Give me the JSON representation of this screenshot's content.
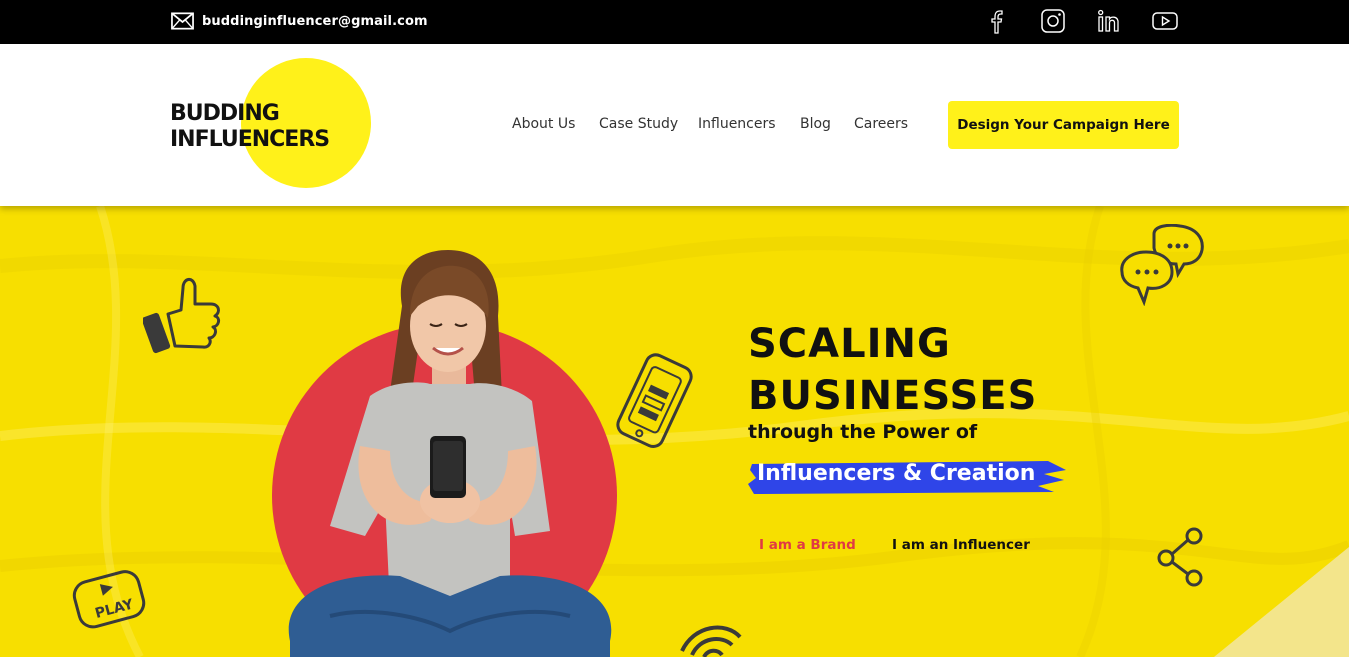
{
  "topbar": {
    "email": "buddinginfluencer@gmail.com",
    "icons": [
      "mail-icon",
      "facebook-icon",
      "instagram-icon",
      "linkedin-icon",
      "youtube-icon"
    ]
  },
  "header": {
    "logo_line1": "BUDDING",
    "logo_line2": "INFLUENCERS",
    "nav": [
      "About Us",
      "Case Study",
      "Influencers",
      "Blog",
      "Careers"
    ],
    "cta": "Design Your Campaign Here"
  },
  "hero": {
    "headline_line1": "SCALING",
    "headline_line2": "BUSINESSES",
    "subline": "through the Power of",
    "highlight": "Influencers & Creation",
    "brand_button": "I am a Brand",
    "influencer_button": "I am an Influencer",
    "doodles": [
      "thumbs-up-icon",
      "phone-doodle-icon",
      "chat-bubbles-icon",
      "share-icon",
      "play-button-icon",
      "wifi-icon"
    ]
  },
  "colors": {
    "accent_yellow": "#fff11a",
    "hero_yellow": "#f7df00",
    "brand_red": "#e03a44",
    "highlight_blue": "#2f45e8",
    "topbar_black": "#000000"
  }
}
